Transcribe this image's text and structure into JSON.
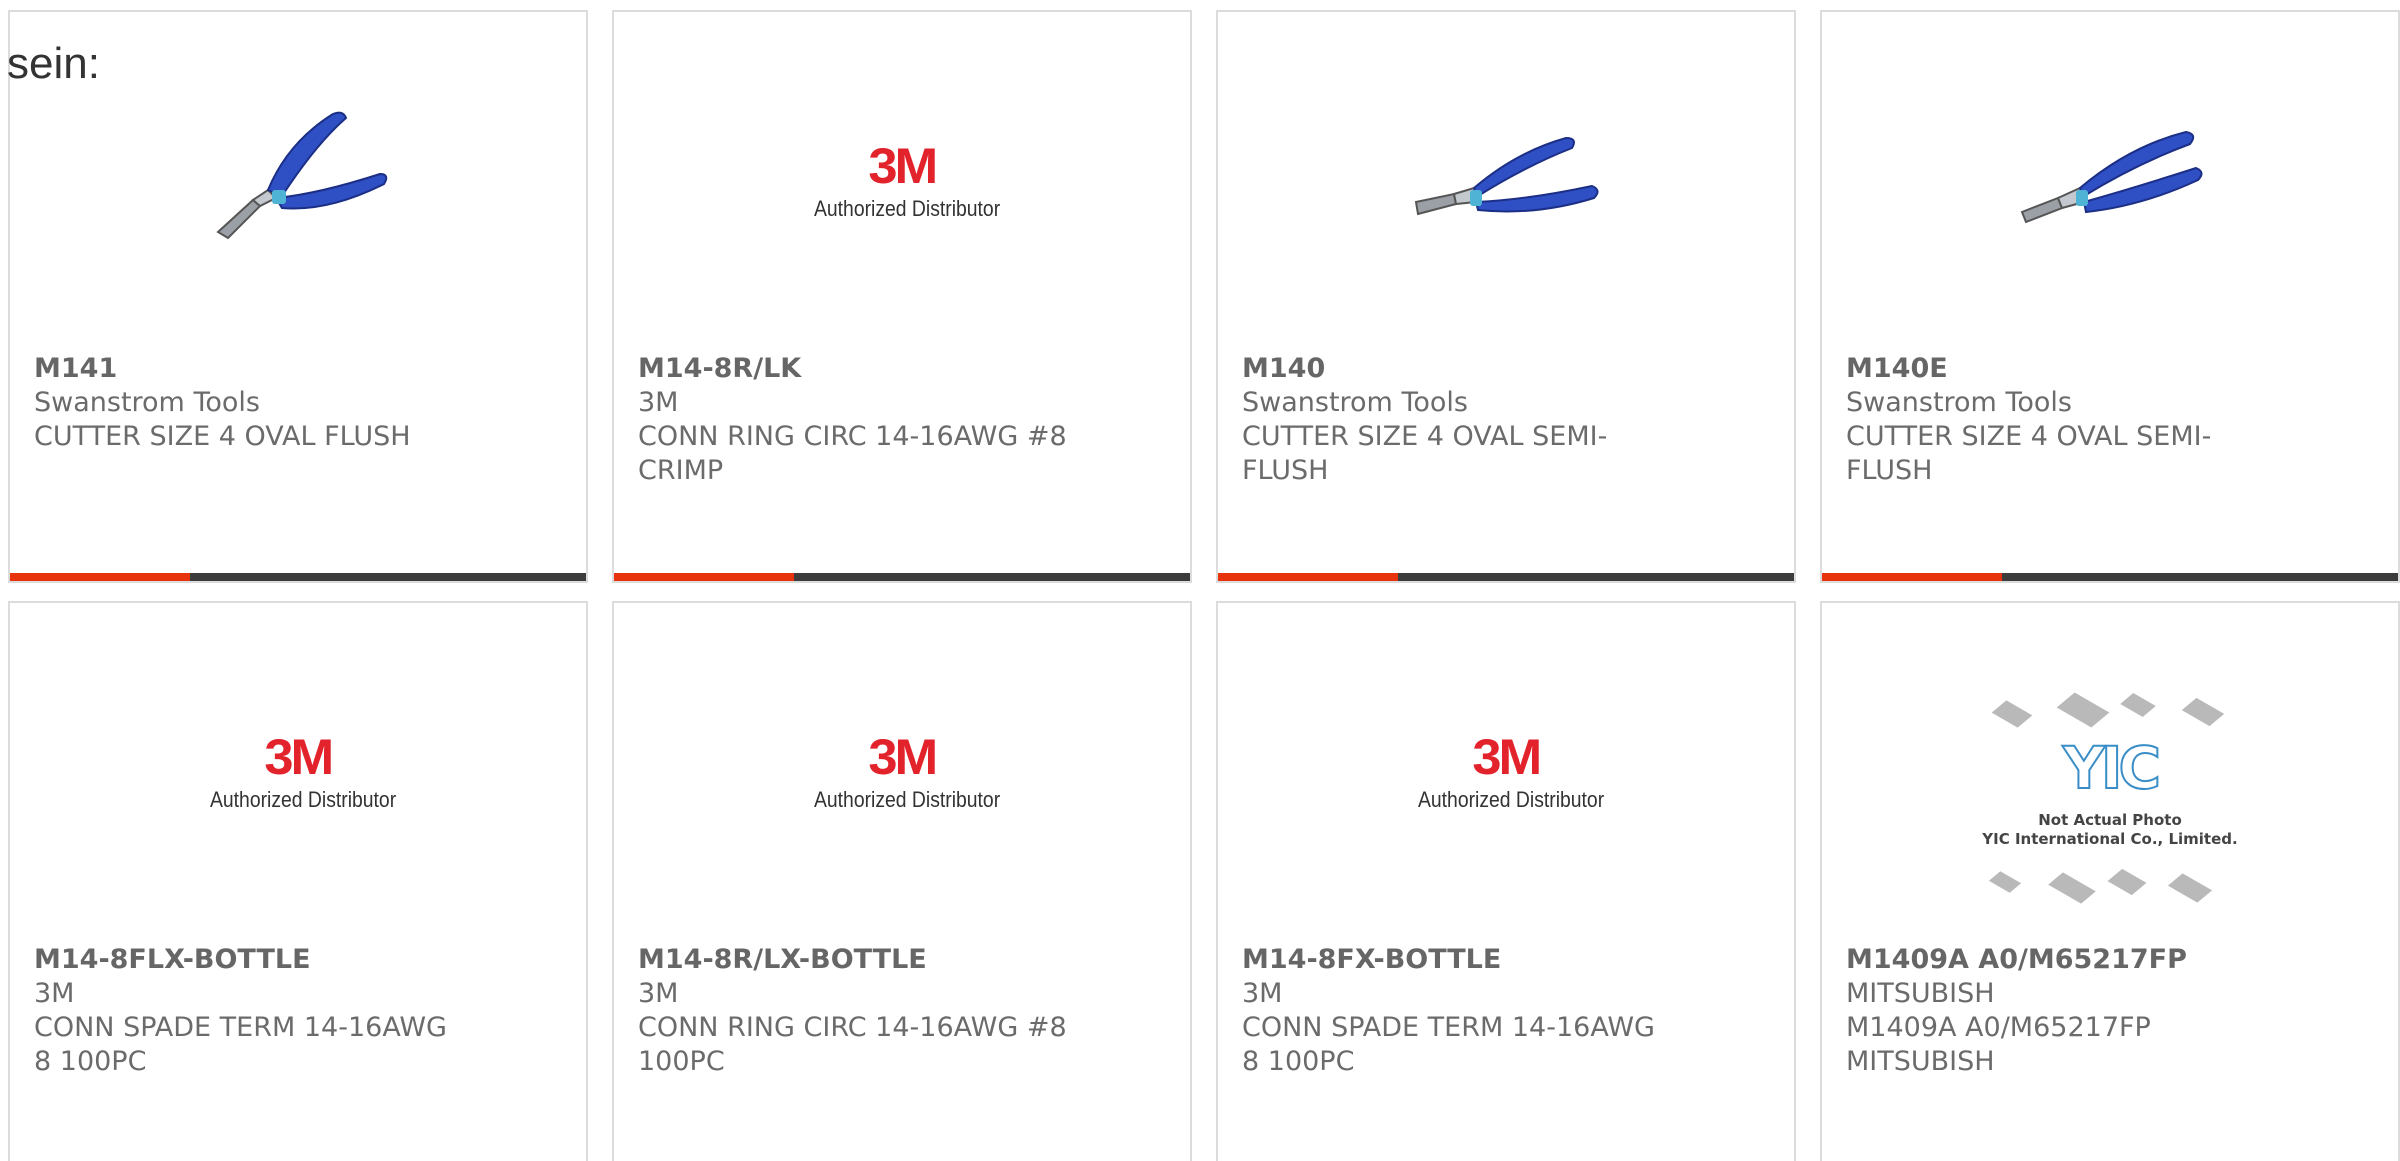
{
  "heading": "sein:",
  "products": [
    {
      "part": "M141",
      "maker": "Swanstrom Tools",
      "description": "CUTTER SIZE 4 OVAL FLUSH",
      "image": "cutter-pliers-photo"
    },
    {
      "part": "M14-8R/LK",
      "maker": "3M",
      "description": "CONN RING CIRC 14-16AWG #8 CRIMP",
      "image": "3m-authorized-distributor-logo"
    },
    {
      "part": "M140",
      "maker": "Swanstrom Tools",
      "description": "CUTTER SIZE 4 OVAL SEMI-FLUSH",
      "image": "cutter-pliers-photo"
    },
    {
      "part": "M140E",
      "maker": "Swanstrom Tools",
      "description": "CUTTER SIZE 4 OVAL SEMI-FLUSH",
      "image": "cutter-pliers-photo"
    },
    {
      "part": "M14-8FLX-BOTTLE",
      "maker": "3M",
      "description": "CONN SPADE TERM 14-16AWG 8 100PC",
      "image": "3m-authorized-distributor-logo"
    },
    {
      "part": "M14-8R/LX-BOTTLE",
      "maker": "3M",
      "description": "CONN RING CIRC 14-16AWG #8 100PC",
      "image": "3m-authorized-distributor-logo"
    },
    {
      "part": "M14-8FX-BOTTLE",
      "maker": "3M",
      "description": "CONN SPADE TERM 14-16AWG 8 100PC",
      "image": "3m-authorized-distributor-logo"
    },
    {
      "part": "M1409A A0/M65217FP",
      "maker": "MITSUBISH",
      "description": "M1409A A0/M65217FP MITSUBISH",
      "image": "yic-not-actual-photo-placeholder"
    }
  ],
  "logo_3m": {
    "mark": "3M",
    "subtitle": "Authorized Distributor"
  },
  "yic_placeholder": {
    "logo": "YIC",
    "line1": "Not Actual Photo",
    "line2": "YIC International Co., Limited."
  },
  "colors": {
    "accent": "#e8340c",
    "bar": "#3c3c3c",
    "border": "#dcdcdc",
    "logo_red": "#e3232c",
    "pliers_blue": "#2f4fc4"
  }
}
